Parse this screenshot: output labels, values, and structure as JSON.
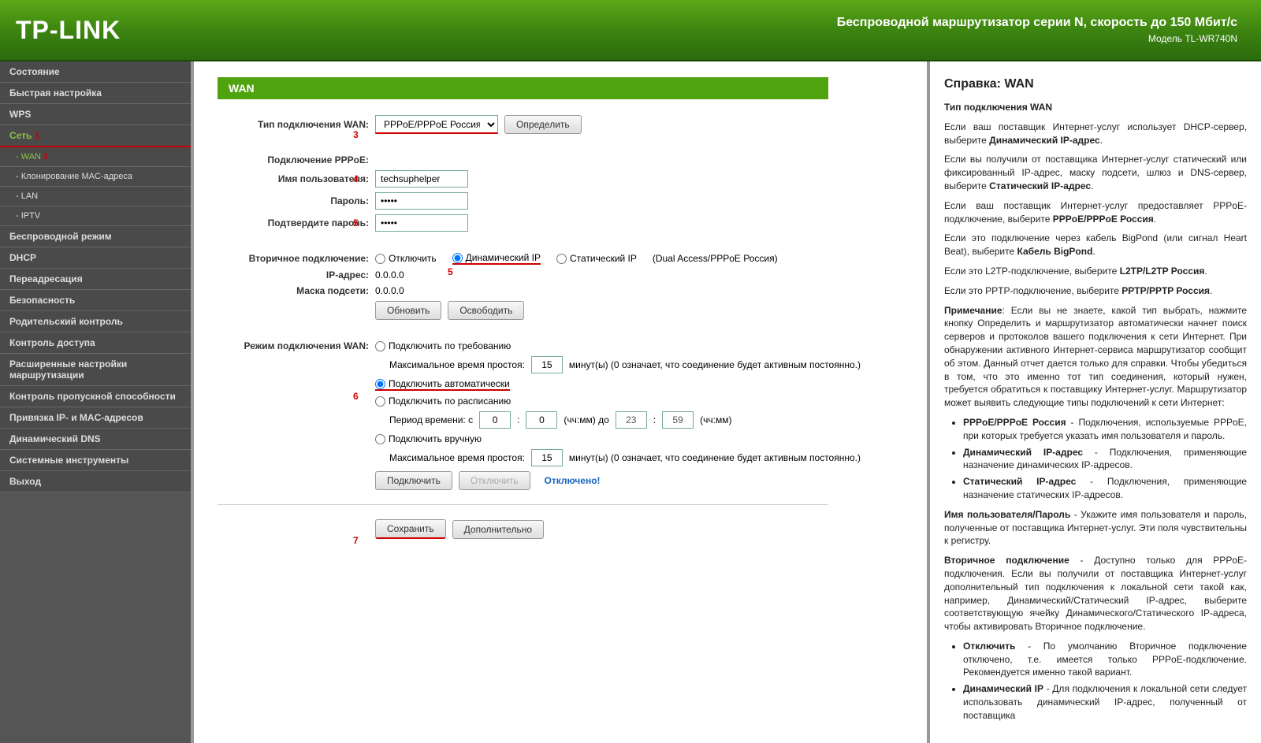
{
  "header": {
    "logo": "TP-LINK",
    "title": "Беспроводной маршрутизатор серии N, скорость до 150 Мбит/с",
    "model": "Модель TL-WR740N"
  },
  "sidebar": {
    "items": [
      {
        "label": "Состояние",
        "type": "top"
      },
      {
        "label": "Быстрая настройка",
        "type": "top"
      },
      {
        "label": "WPS",
        "type": "top"
      },
      {
        "label": "Сеть",
        "type": "top",
        "selected": true,
        "annotation": "1"
      },
      {
        "label": "- WAN",
        "type": "sub",
        "active": true,
        "annotation": "2"
      },
      {
        "label": "- Клонирование MAC-адреса",
        "type": "sub"
      },
      {
        "label": "- LAN",
        "type": "sub"
      },
      {
        "label": "- IPTV",
        "type": "sub"
      },
      {
        "label": "Беспроводной режим",
        "type": "top"
      },
      {
        "label": "DHCP",
        "type": "top"
      },
      {
        "label": "Переадресация",
        "type": "top"
      },
      {
        "label": "Безопасность",
        "type": "top"
      },
      {
        "label": "Родительский контроль",
        "type": "top"
      },
      {
        "label": "Контроль доступа",
        "type": "top"
      },
      {
        "label": "Расширенные настройки маршрутизации",
        "type": "top"
      },
      {
        "label": "Контроль пропускной способности",
        "type": "top"
      },
      {
        "label": "Привязка IP- и MAC-адресов",
        "type": "top"
      },
      {
        "label": "Динамический DNS",
        "type": "top"
      },
      {
        "label": "Системные инструменты",
        "type": "top"
      },
      {
        "label": "Выход",
        "type": "top"
      }
    ]
  },
  "main": {
    "title": "WAN",
    "wan_type_label": "Тип подключения WAN:",
    "wan_type_value": "PPPoE/PPPoE Россия",
    "detect_btn": "Определить",
    "pppoe_label": "Подключение PPPoE:",
    "username_label": "Имя пользователя:",
    "username_value": "techsuphelper",
    "password_label": "Пароль:",
    "password_value": "•••••",
    "confirm_label": "Подтвердите пароль:",
    "confirm_value": "•••••",
    "secondary_label": "Вторичное подключение:",
    "sec_disable": "Отключить",
    "sec_dynamic": "Динамический IP",
    "sec_static": "Статический IP",
    "sec_hint": "(Dual Access/PPPoE Россия)",
    "ip_label": "IP-адрес:",
    "ip_value": "0.0.0.0",
    "mask_label": "Маска подсети:",
    "mask_value": "0.0.0.0",
    "renew_btn": "Обновить",
    "release_btn": "Освободить",
    "conn_mode_label": "Режим подключения WAN:",
    "demand": "Подключить по требованию",
    "max_idle_label": "Максимальное время простоя:",
    "max_idle_value": "15",
    "minutes_hint": "минут(ы) (0 означает, что соединение будет активным постоянно.)",
    "auto": "Подключить автоматически",
    "schedule": "Подключить по расписанию",
    "period_label": "Период времени:  с",
    "hh_from": "0",
    "mm_from": "0",
    "period_mid": "(чч:мм) до",
    "hh_to": "23",
    "mm_to": "59",
    "period_end": "(чч:мм)",
    "manual": "Подключить вручную",
    "max_idle_value2": "15",
    "connect_btn": "Подключить",
    "disconnect_btn": "Отключить",
    "status": "Отключено!",
    "save_btn": "Сохранить",
    "advanced_btn": "Дополнительно"
  },
  "help": {
    "title": "Справка: WAN",
    "h_type": "Тип подключения WAN",
    "p1a": "Если ваш поставщик Интернет-услуг использует DHCP-сервер, выберите ",
    "p1b": "Динамический IP-адрес",
    "p2a": "Если вы получили от поставщика Интернет-услуг статический или фиксированный IP-адрес, маску подсети, шлюз и DNS-сервер, выберите ",
    "p2b": "Статический IP-адрес",
    "p3a": "Если ваш поставщик Интернет-услуг предоставляет PPPoE-подключение, выберите ",
    "p3b": "PPPoE/PPPoE Россия",
    "p4a": "Если это подключение через кабель BigPond (или сигнал Heart Beat), выберите ",
    "p4b": "Кабель BigPond",
    "p5a": "Если это L2TP-подключение, выберите ",
    "p5b": "L2TP/L2TP Россия",
    "p6a": "Если это PPTP-подключение, выберите ",
    "p6b": "PPTP/PPTP Россия",
    "note_label": "Примечание",
    "note_text": ": Если вы не знаете, какой тип выбрать, нажмите кнопку Определить и маршрутизатор автоматически начнет поиск серверов и протоколов вашего подключения к сети Интернет. При обнаружении активного Интернет-сервиса маршрутизатор сообщит об этом. Данный отчет дается только для справки. Чтобы убедиться в том, что это именно тот тип соединения, который нужен, требуется обратиться к поставщику Интернет-услуг. Маршрутизатор может выявить следующие типы подключений к сети Интернет:",
    "li1a": "PPPoE/PPPoE Россия",
    "li1b": " - Подключения, используемые PPPoE, при которых требуется указать имя пользователя и пароль.",
    "li2a": "Динамический IP-адрес",
    "li2b": " - Подключения, применяющие назначение динамических IP-адресов.",
    "li3a": "Статический IP-адрес",
    "li3b": " - Подключения, применяющие назначение статических IP-адресов.",
    "userpwd_label": "Имя пользователя/Пароль",
    "userpwd_text": " - Укажите имя пользователя и пароль, полученные от поставщика Интернет-услуг. Эти поля чувствительны к регистру.",
    "sec_label": "Вторичное подключение",
    "sec_text": " - Доступно только для PPPoE-подключения. Если вы получили от поставщика Интернет-услуг дополнительный тип подключения к локальной сети такой как, например, Динамический/Статический IP-адрес, выберите соответствующую ячейку Динамического/Статического IP-адреса, чтобы активировать Вторичное подключение.",
    "so1a": "Отключить",
    "so1b": " - По умолчанию Вторичное подключение отключено, т.е. имеется только PPPoE-подключение. Рекомендуется именно такой вариант.",
    "so2a": "Динамический IP",
    "so2b": " - Для подключения к локальной сети следует использовать динамический IP-адрес, полученный от поставщика"
  },
  "annotations": {
    "a3": "3",
    "a4": "4",
    "a5a": "5",
    "a5b": "5",
    "a6": "6",
    "a7": "7"
  }
}
